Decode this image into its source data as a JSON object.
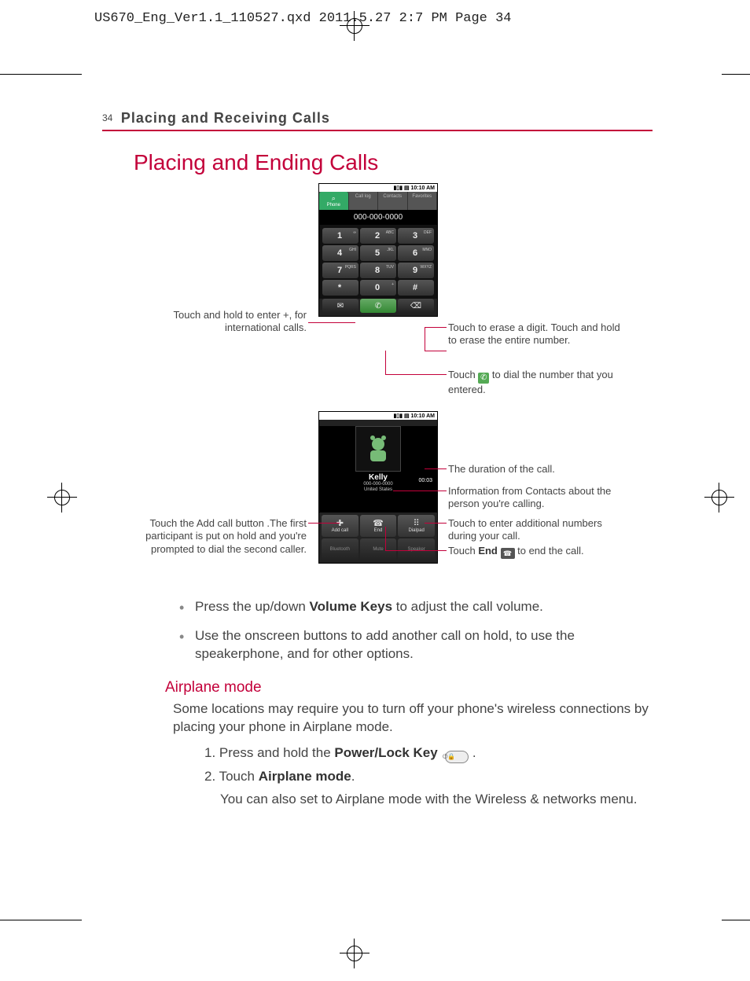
{
  "print_header": "US670_Eng_Ver1.1_110527.qxd  2011.5.27  2:7 PM  Page 34",
  "running_head": {
    "page_number": "34",
    "title": "Placing and Receiving Calls"
  },
  "h1": "Placing and Ending Calls",
  "phone1": {
    "status_time": "10:10 AM",
    "tabs": [
      "Phone",
      "Call log",
      "Contacts",
      "Favorites"
    ],
    "display_number": "000-000-0000",
    "keys": [
      {
        "d": "1",
        "l": "∞"
      },
      {
        "d": "2",
        "l": "ABC"
      },
      {
        "d": "3",
        "l": "DEF"
      },
      {
        "d": "4",
        "l": "GHI"
      },
      {
        "d": "5",
        "l": "JKL"
      },
      {
        "d": "6",
        "l": "MNO"
      },
      {
        "d": "7",
        "l": "PQRS"
      },
      {
        "d": "8",
        "l": "TUV"
      },
      {
        "d": "9",
        "l": "WXYZ"
      },
      {
        "d": "*",
        "l": ""
      },
      {
        "d": "0",
        "l": "+"
      },
      {
        "d": "#",
        "l": ""
      }
    ]
  },
  "callout_left1": "Touch and hold to enter +, for international calls.",
  "callout_r1": "Touch to erase a digit. Touch and hold to erase the entire number.",
  "callout_r2a": "Touch ",
  "callout_r2b": " to dial the number that you entered.",
  "phone2": {
    "status_time": "10:10 AM",
    "duration": "00:03",
    "name": "Kelly",
    "number": "000-000-0000",
    "location": "United States",
    "buttons": [
      "Add call",
      "End",
      "Dialpad",
      "Bluetooth",
      "Mute",
      "Speaker"
    ]
  },
  "callout_r3": "The duration of the call.",
  "callout_r4": "Information from Contacts about the person you're calling.",
  "callout_r5": "Touch to enter additional numbers during your call.",
  "callout_r6a": "Touch ",
  "callout_r6b": "End",
  "callout_r6c": " to end the call.",
  "callout_left2": "Touch the Add call button .The first participant is put on hold and you're prompted to dial the second caller.",
  "bullets": [
    {
      "pre": "Press the up/down ",
      "bold": "Volume Keys",
      "post": " to adjust the call volume."
    },
    {
      "pre": "Use the onscreen buttons to add another call on hold, to use the speakerphone, and for other options.",
      "bold": "",
      "post": ""
    }
  ],
  "h2": "Airplane mode",
  "para1": "Some locations may require you to turn off your phone's wireless connections by placing your phone in Airplane mode.",
  "step1": {
    "pre": "1. Press and hold the ",
    "bold": "Power/Lock Key",
    "post": " ."
  },
  "step2": {
    "pre": "2. Touch ",
    "bold": "Airplane mode",
    "post": "."
  },
  "step2_sub": "You can also set to Airplane mode with the Wireless & networks menu."
}
